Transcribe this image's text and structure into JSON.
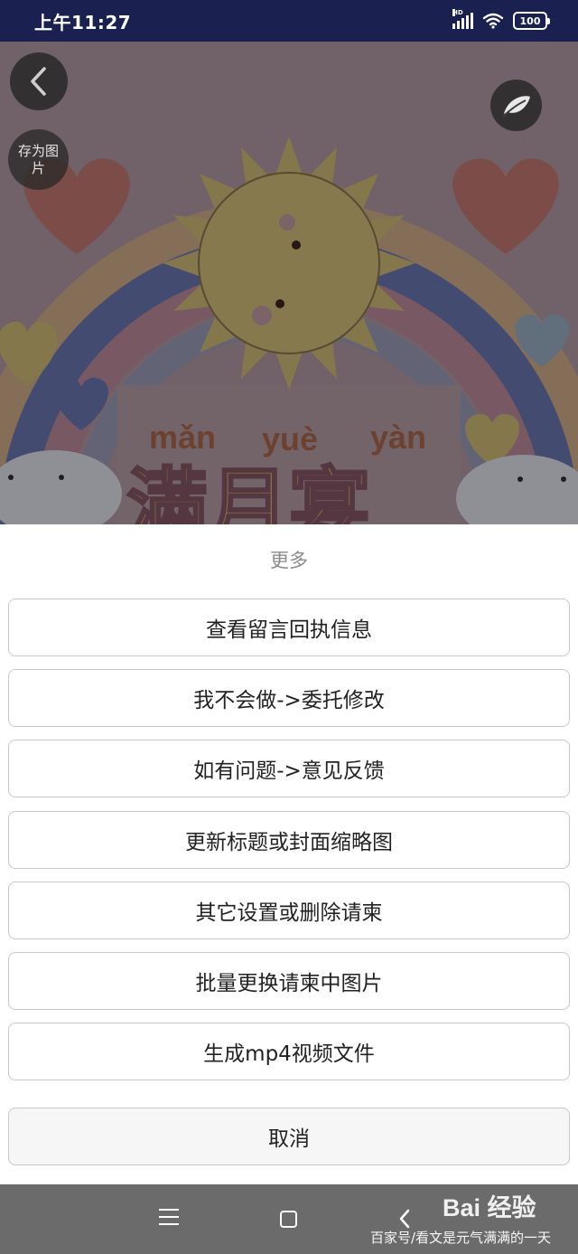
{
  "status_bar": {
    "time": "上午11:27",
    "network": "HD",
    "battery": "100"
  },
  "overlay_buttons": {
    "back_icon": "chevron-left-icon",
    "save_image_label": "存为图片",
    "leaf_icon": "leaf-icon"
  },
  "poster": {
    "pinyin": [
      "mǎn",
      "yuè",
      "yàn"
    ],
    "title": "满月宴"
  },
  "sheet": {
    "title": "更多",
    "options": [
      "查看留言回执信息",
      "我不会做->委托修改",
      "如有问题->意见反馈",
      "更新标题或封面缩略图",
      "其它设置或删除请柬",
      "批量更换请柬中图片",
      "生成mp4视频文件"
    ],
    "cancel": "取消"
  },
  "nav_bar": {
    "icons": [
      "menu-icon",
      "home-icon",
      "back-icon"
    ]
  },
  "watermark": {
    "logo": "Bai 经验",
    "text": "百家号/看文是元气满满的一天"
  }
}
